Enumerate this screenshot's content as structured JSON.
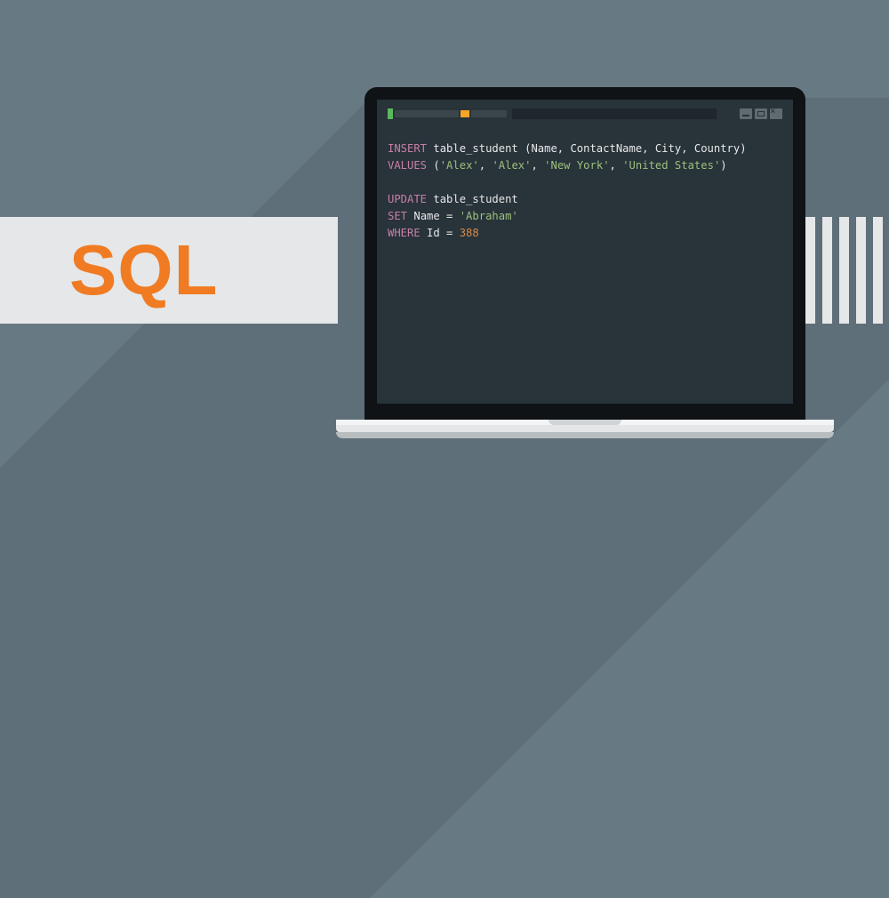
{
  "branding": {
    "label": "SQL"
  },
  "code": {
    "line1": {
      "kw1": "INSERT",
      "ident": " table_student ",
      "paren_open": "(",
      "cols": "Name, ContactName, City, Country",
      "paren_close": ")"
    },
    "line2": {
      "kw": "VALUES",
      "space": " ",
      "po": "(",
      "v1": "'Alex'",
      "c1": ", ",
      "v2": "'Alex'",
      "c2": ", ",
      "v3": "'New York'",
      "c3": ", ",
      "v4": "'United States'",
      "pc": ")"
    },
    "line4": {
      "kw": "UPDATE",
      "ident": " table_student"
    },
    "line5": {
      "kw": "SET",
      "ident": " Name = ",
      "val": "'Abraham'"
    },
    "line6": {
      "kw": "WHERE",
      "ident": " Id = ",
      "num": "388"
    }
  }
}
